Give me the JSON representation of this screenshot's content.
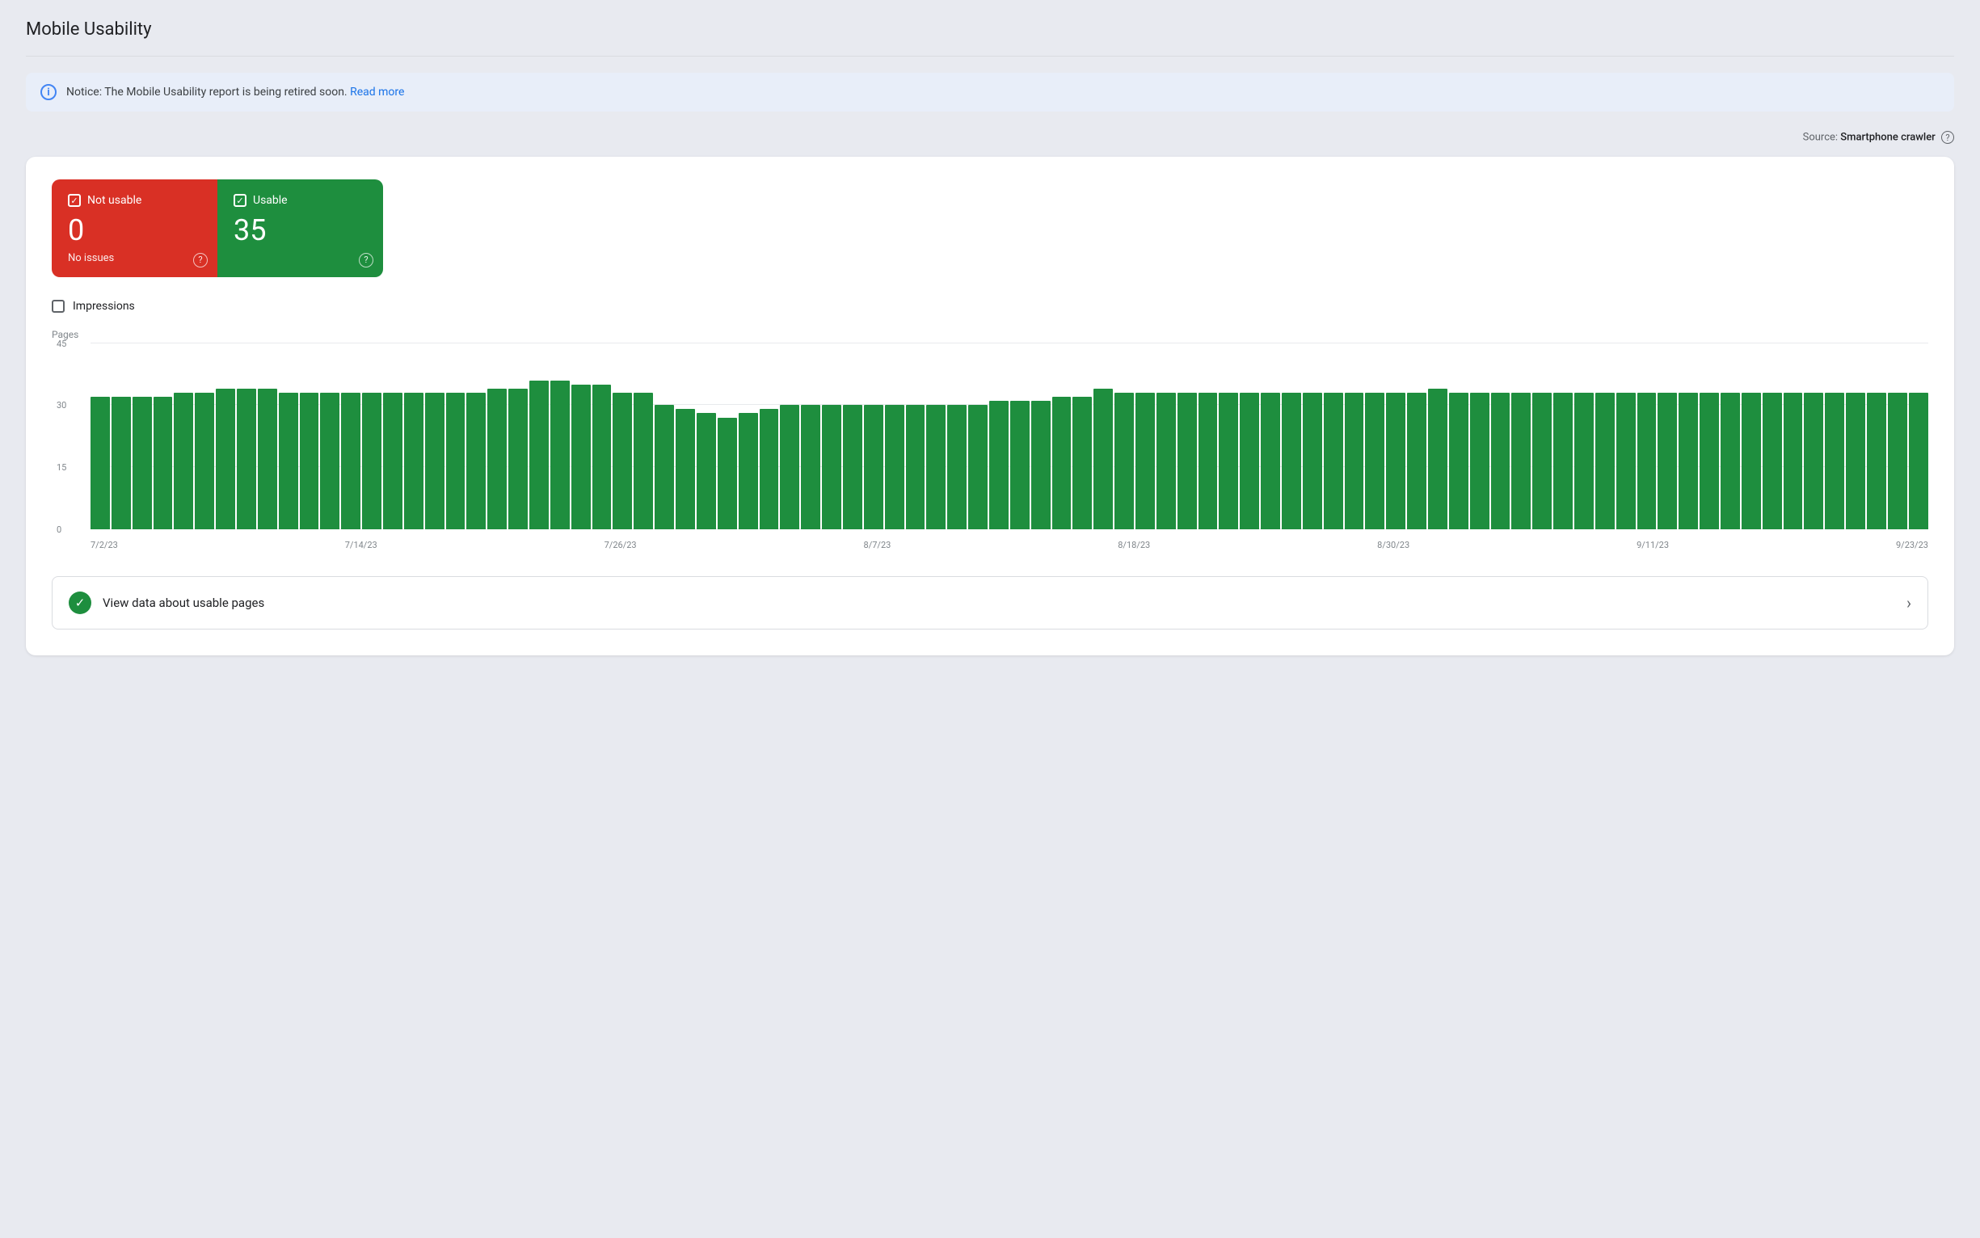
{
  "page": {
    "title": "Mobile Usability"
  },
  "notice": {
    "text": "Notice: The Mobile Usability report is being retired soon.",
    "link_text": "Read more",
    "link_href": "#"
  },
  "source": {
    "label": "Source:",
    "value": "Smartphone crawler"
  },
  "status_cards": {
    "not_usable": {
      "label": "Not usable",
      "count": "0",
      "description": "No issues",
      "help": "?"
    },
    "usable": {
      "label": "Usable",
      "count": "35",
      "help": "?"
    }
  },
  "impressions": {
    "label": "Impressions"
  },
  "chart": {
    "y_label": "Pages",
    "grid_lines": [
      {
        "value": 45,
        "pct": 100
      },
      {
        "value": 30,
        "pct": 66.7
      },
      {
        "value": 15,
        "pct": 33.3
      },
      {
        "value": 0,
        "pct": 0
      }
    ],
    "x_labels": [
      "7/2/23",
      "7/14/23",
      "7/26/23",
      "8/7/23",
      "8/18/23",
      "8/30/23",
      "9/11/23",
      "9/23/23"
    ],
    "bars": [
      32,
      32,
      32,
      32,
      33,
      33,
      34,
      34,
      34,
      33,
      33,
      33,
      33,
      33,
      33,
      33,
      33,
      33,
      33,
      34,
      34,
      36,
      36,
      35,
      35,
      33,
      33,
      30,
      29,
      28,
      27,
      28,
      29,
      30,
      30,
      30,
      30,
      30,
      30,
      30,
      30,
      30,
      30,
      31,
      31,
      31,
      32,
      32,
      34,
      33,
      33,
      33,
      33,
      33,
      33,
      33,
      33,
      33,
      33,
      33,
      33,
      33,
      33,
      33,
      34,
      33,
      33,
      33,
      33,
      33,
      33,
      33,
      33,
      33,
      33,
      33,
      33,
      33,
      33,
      33,
      33,
      33,
      33,
      33,
      33,
      33,
      33,
      33
    ]
  },
  "view_data": {
    "label": "View data about usable pages"
  }
}
